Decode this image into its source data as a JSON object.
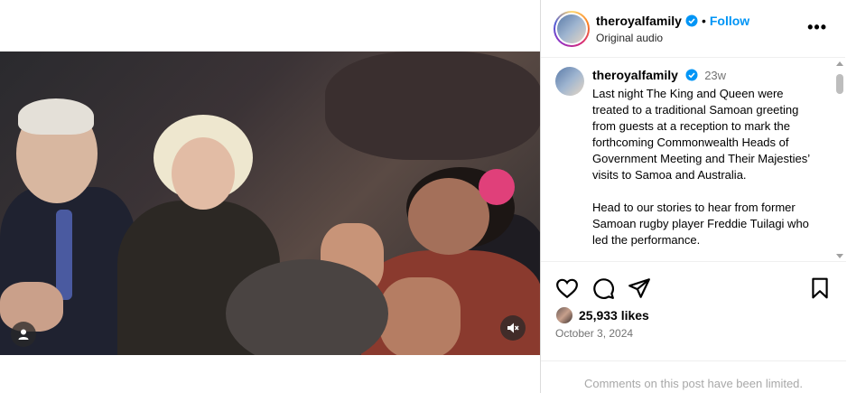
{
  "header": {
    "username": "theroyalfamily",
    "separator": "•",
    "follow_label": "Follow",
    "audio": "Original audio",
    "more_label": "•••"
  },
  "caption": {
    "username": "theroyalfamily",
    "time": "23w",
    "paragraph1": "Last night The King and Queen were treated to a traditional Samoan greeting from guests at a reception to mark the forthcoming Commonwealth Heads of Government Meeting and Their Majesties’ visits to Samoa and Australia.",
    "paragraph2": "Head to our stories to hear from former Samoan rugby player Freddie Tuilagi who led the performance."
  },
  "likes": {
    "count": "25,933 likes"
  },
  "date": "October 3, 2024",
  "comments_notice": "Comments on this post have been limited.",
  "colors": {
    "accent": "#0095f6",
    "muted": "#737373",
    "verified": "#0095f6"
  },
  "icons": [
    "user-icon",
    "mute-icon",
    "heart-icon",
    "comment-icon",
    "share-icon",
    "save-icon",
    "verified-icon",
    "more-icon"
  ]
}
